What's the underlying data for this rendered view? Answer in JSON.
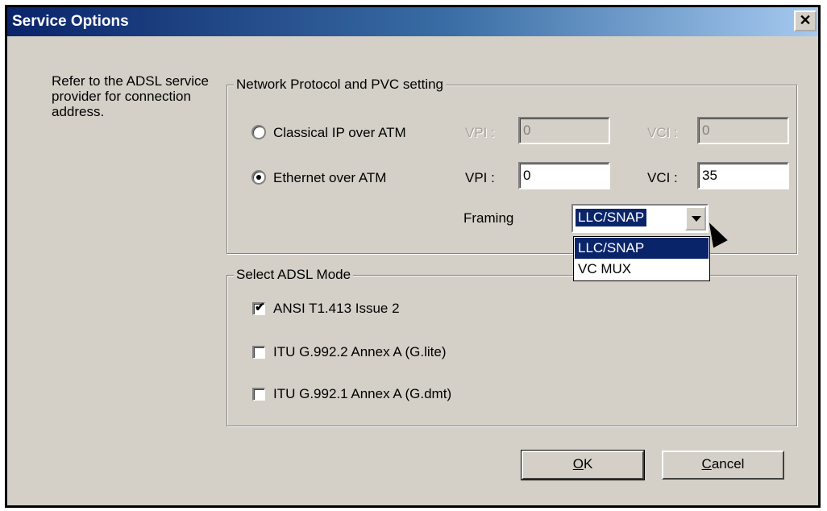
{
  "window": {
    "title": "Service Options",
    "close_glyph": "✕"
  },
  "info_text": "Refer to the ADSL service provider for connection address.",
  "network_group": {
    "label": "Network Protocol and PVC setting",
    "options": [
      {
        "label": "Classical IP over ATM",
        "selected": false,
        "vpi_label": "VPI :",
        "vpi": "0",
        "vci_label": "VCI :",
        "vci": "0",
        "enabled": false
      },
      {
        "label": "Ethernet over ATM",
        "selected": true,
        "vpi_label": "VPI :",
        "vpi": "0",
        "vci_label": "VCI :",
        "vci": "35",
        "enabled": true
      }
    ],
    "framing_label": "Framing",
    "framing_value": "LLC/SNAP",
    "framing_options": [
      "LLC/SNAP",
      "VC MUX"
    ]
  },
  "mode_group": {
    "label": "Select ADSL Mode",
    "options": [
      {
        "label": "ANSI T1.413 Issue 2",
        "checked": true
      },
      {
        "label": "ITU G.992.2 Annex A (G.lite)",
        "checked": false
      },
      {
        "label": "ITU G.992.1 Annex A (G.dmt)",
        "checked": false
      }
    ]
  },
  "buttons": {
    "ok_mnemonic": "O",
    "ok_rest": "K",
    "cancel_mnemonic": "C",
    "cancel_rest": "ancel"
  },
  "icons": {
    "check": "✔"
  },
  "colors": {
    "title_start": "#0a246a",
    "title_end": "#a6caf0",
    "face": "#d4d0c8",
    "highlight": "#0a246a"
  }
}
